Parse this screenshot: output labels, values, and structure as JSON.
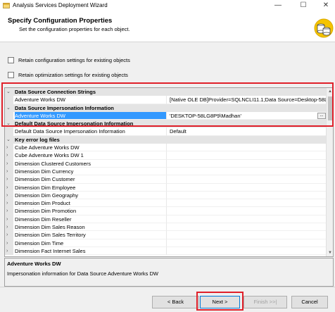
{
  "window": {
    "title": "Analysis Services Deployment Wizard",
    "minimize": "—",
    "maximize": "☐",
    "close": "✕"
  },
  "header": {
    "title": "Specify Configuration Properties",
    "subtitle": "Set the configuration properties for each object."
  },
  "options": {
    "retain_config": "Retain configuration settings for existing objects",
    "retain_optim": "Retain optimization settings for existing objects"
  },
  "grid": {
    "cat1": "Data Source Connection Strings",
    "r1_name": "Adventure Works DW",
    "r1_value": "[Native OLE DB]Provider=SQLNCLI11.1;Data Source=Desktop-58LG8P9",
    "cat2": "Data Source Impersonation Information",
    "r2_name": "Adventure Works DW",
    "r2_value": "'DESKTOP-58LG8P9\\Madhan'",
    "ellipsis": "...",
    "cat3": "Default Data Source Impersonation Information",
    "r3_name": "Default Data Source Impersonation Information",
    "r3_value": "Default",
    "cat4": "Key error log files",
    "items": [
      "Cube Adventure Works DW",
      "Cube Adventure Works DW 1",
      "Dimension Clustered Customers",
      "Dimension Dim Currency",
      "Dimension Dim Customer",
      "Dimension Dim Employee",
      "Dimension Dim Geography",
      "Dimension Dim Product",
      "Dimension Dim Promotion",
      "Dimension Dim Reseller",
      "Dimension Dim Sales Reason",
      "Dimension Dim Sales Territory",
      "Dimension Dim Time",
      "Dimension Fact Internet Sales"
    ]
  },
  "description": {
    "title": "Adventure Works DW",
    "text": "Impersonation information for Data Source Adventure Works DW"
  },
  "buttons": {
    "back": "< Back",
    "next": "Next >",
    "finish": "Finish >>|",
    "cancel": "Cancel"
  }
}
